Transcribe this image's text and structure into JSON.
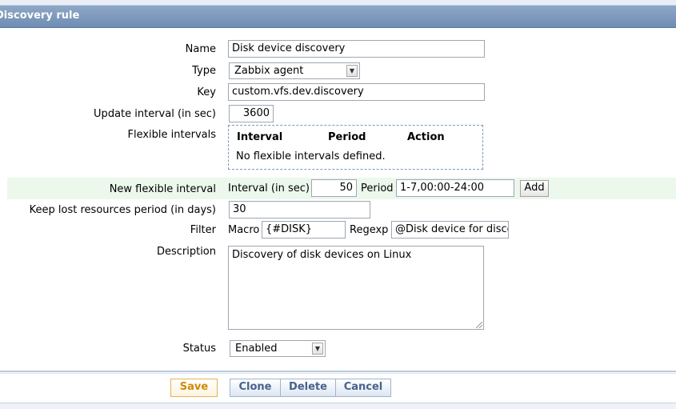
{
  "header": {
    "title": "Discovery rule"
  },
  "form": {
    "name": {
      "label": "Name",
      "value": "Disk device discovery"
    },
    "type": {
      "label": "Type",
      "value": "Zabbix agent"
    },
    "key": {
      "label": "Key",
      "value": "custom.vfs.dev.discovery"
    },
    "update_interval": {
      "label": "Update interval (in sec)",
      "value": "3600"
    },
    "flexible_intervals": {
      "label": "Flexible intervals",
      "columns": [
        "Interval",
        "Period",
        "Action"
      ],
      "empty_text": "No flexible intervals defined."
    },
    "new_flexible_interval": {
      "label": "New flexible interval",
      "interval_label": "Interval (in sec)",
      "interval_value": "50",
      "period_label": "Period",
      "period_value": "1-7,00:00-24:00",
      "add_label": "Add"
    },
    "keep_lost": {
      "label": "Keep lost resources period (in days)",
      "value": "30"
    },
    "filter": {
      "label": "Filter",
      "macro_label": "Macro",
      "macro_value": "{#DISK}",
      "regexp_label": "Regexp",
      "regexp_value": "@Disk device for disco"
    },
    "description": {
      "label": "Description",
      "value": "Discovery of disk devices on Linux"
    },
    "status": {
      "label": "Status",
      "value": "Enabled"
    }
  },
  "buttons": {
    "save": "Save",
    "clone": "Clone",
    "delete": "Delete",
    "cancel": "Cancel"
  },
  "icons": {
    "dropdown": "chevron-down-icon",
    "resize": "resize-grip-icon"
  }
}
